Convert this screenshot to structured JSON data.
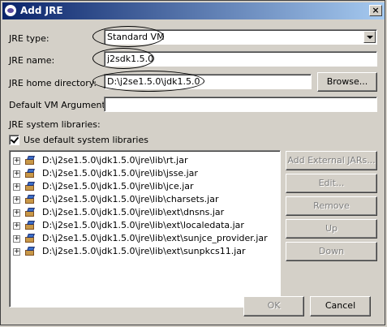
{
  "window": {
    "title": "Add JRE",
    "close_label": "×"
  },
  "form": {
    "jre_type_label": "JRE type:",
    "jre_type_value": "Standard VM",
    "jre_name_label": "JRE name:",
    "jre_name_value": "j2sdk1.5.0",
    "jre_home_label": "JRE home directory:",
    "jre_home_value": "D:\\j2se1.5.0\\jdk1.5.0",
    "browse_label": "Browse...",
    "vm_args_label": "Default VM Arguments:",
    "vm_args_value": "",
    "system_libraries_label": "JRE system libraries:",
    "use_default_label": "Use default system libraries",
    "use_default_checked": true
  },
  "libraries": [
    {
      "path": "D:\\j2se1.5.0\\jdk1.5.0\\jre\\lib\\rt.jar"
    },
    {
      "path": "D:\\j2se1.5.0\\jdk1.5.0\\jre\\lib\\jsse.jar"
    },
    {
      "path": "D:\\j2se1.5.0\\jdk1.5.0\\jre\\lib\\jce.jar"
    },
    {
      "path": "D:\\j2se1.5.0\\jdk1.5.0\\jre\\lib\\charsets.jar"
    },
    {
      "path": "D:\\j2se1.5.0\\jdk1.5.0\\jre\\lib\\ext\\dnsns.jar"
    },
    {
      "path": "D:\\j2se1.5.0\\jdk1.5.0\\jre\\lib\\ext\\localedata.jar"
    },
    {
      "path": "D:\\j2se1.5.0\\jdk1.5.0\\jre\\lib\\ext\\sunjce_provider.jar"
    },
    {
      "path": "D:\\j2se1.5.0\\jdk1.5.0\\jre\\lib\\ext\\sunpkcs11.jar"
    }
  ],
  "library_buttons": {
    "add_external_jars": "Add External JARs...",
    "edit": "Edit...",
    "remove": "Remove",
    "up": "Up",
    "down": "Down"
  },
  "footer": {
    "ok": "OK",
    "cancel": "Cancel"
  },
  "tree_expander": "+"
}
